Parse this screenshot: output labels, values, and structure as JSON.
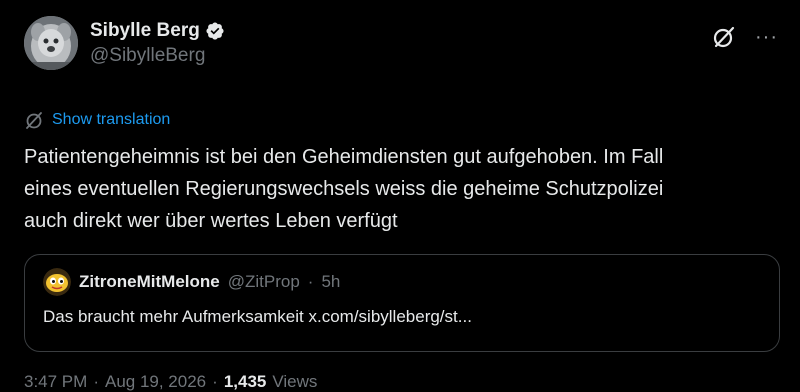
{
  "author": {
    "display_name": "Sibylle Berg",
    "handle": "@SibylleBerg",
    "verified": true
  },
  "icons": {
    "avatar": "avatar-photo",
    "verified": "verified-badge-icon",
    "grok": "grok-icon",
    "more": "more-icon",
    "translate": "translate-icon"
  },
  "colors": {
    "background": "#000000",
    "text": "#e7e9ea",
    "secondary": "#71767b",
    "accent": "#1d9bf0",
    "border": "#3a3d40"
  },
  "more_label": "···",
  "translation": {
    "label": "Show translation"
  },
  "tweet": {
    "lines": [
      "Patientengeheimnis ist bei den Geheimdiensten gut aufgehoben. Im Fall",
      "eines eventuellen Regierungswechsels weiss die geheime Schutzpolizei",
      "auch direkt wer über wertes Leben verfügt"
    ]
  },
  "quote": {
    "display_name": "ZitroneMitMelone",
    "handle": "@ZitProp",
    "separator": "·",
    "time": "5h",
    "text": "Das braucht mehr Aufmerksamkeit x.com/sibylleberg/st..."
  },
  "footer": {
    "time": "3:47 PM",
    "separator": "·",
    "date": "Aug 19, 2026",
    "views_count": "1,435",
    "views_label": "Views"
  }
}
